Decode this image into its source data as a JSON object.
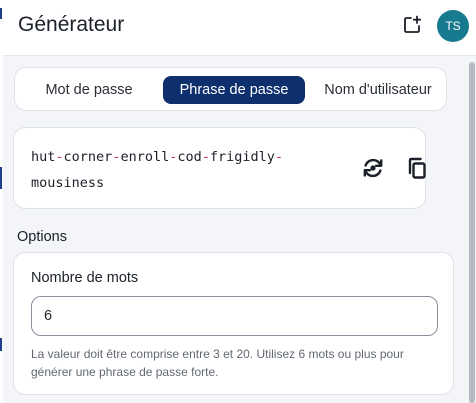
{
  "header": {
    "title": "Générateur",
    "new_icon": "add-square-icon",
    "avatar_initials": "TS"
  },
  "tabs": [
    {
      "label": "Mot de passe",
      "active": false
    },
    {
      "label": "Phrase de passe",
      "active": true
    },
    {
      "label": "Nom d'utilisateur",
      "active": false
    }
  ],
  "generated": {
    "words": [
      "hut",
      "corner",
      "enroll",
      "cod",
      "frigidly",
      "mousiness"
    ],
    "separator": "-",
    "regenerate_icon": "regenerate-icon",
    "copy_icon": "copy-icon"
  },
  "options": {
    "section_label": "Options",
    "word_count_label": "Nombre de mots",
    "word_count_value": "6",
    "hint": "La valeur doit être comprise entre 3 et 20. Utilisez 6 mots ou plus pour générer une phrase de passe forte."
  },
  "colors": {
    "active_tab": "#0e2f6e",
    "avatar": "#187a8e",
    "separator": "#c0356b"
  }
}
